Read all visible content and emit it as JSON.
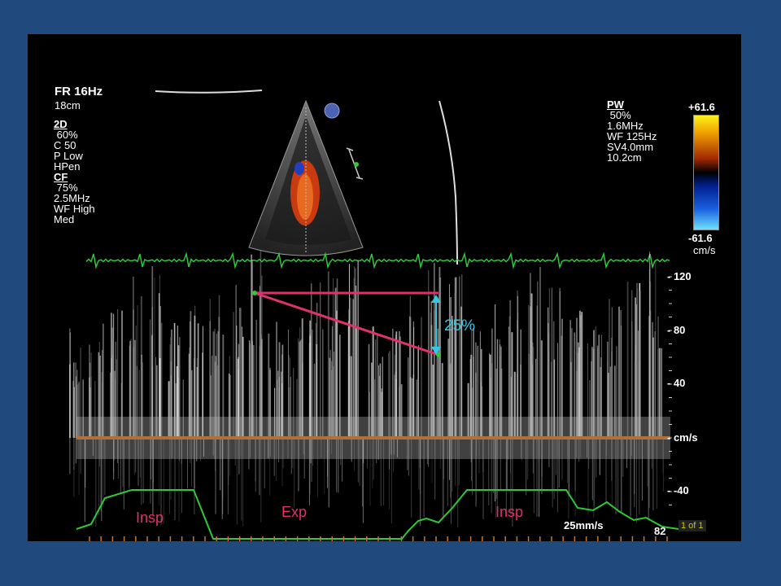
{
  "header": {
    "frame_rate": "FR 16Hz",
    "depth": "18cm"
  },
  "params_2d": {
    "title": "2D",
    "lines": [
      " 60%",
      "C 50",
      "P Low",
      "HPen"
    ]
  },
  "params_cf": {
    "title": "CF",
    "lines": [
      " 75%",
      "2.5MHz",
      "WF High",
      "Med"
    ]
  },
  "params_pw": {
    "title": "PW",
    "lines": [
      " 50%",
      "1.6MHz",
      "WF 125Hz",
      "SV4.0mm",
      "10.2cm"
    ]
  },
  "color_scale": {
    "top": "+61.6",
    "bottom": "-61.6",
    "unit": "cm/s"
  },
  "velocity_scale": {
    "ticks": [
      "- 120",
      "- 80",
      "- 40",
      "- cm/s",
      "- -40"
    ]
  },
  "measurement": {
    "percent": "25%"
  },
  "respiration": {
    "insp_1": "Insp",
    "exp": "Exp",
    "insp_2": "Insp"
  },
  "sweep_speed": "25mm/s",
  "depth_readout": "82",
  "page_indicator": "1 of 1",
  "colors": {
    "background": "#204a7e",
    "ecg": "#2ec83a",
    "measure_line": "#e0306f",
    "percent": "#36c8e0",
    "baseline": "#b0703a"
  }
}
